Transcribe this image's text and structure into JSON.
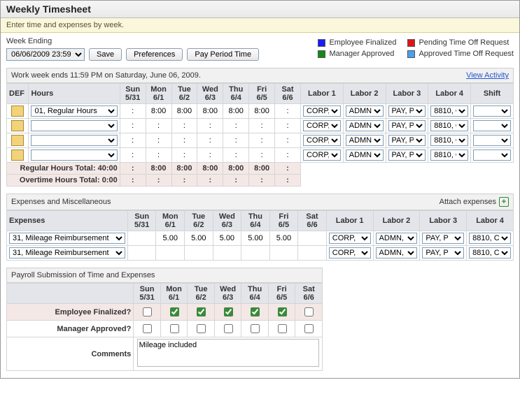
{
  "title": "Weekly Timesheet",
  "instruction": "Enter time and expenses by week.",
  "week_ending_label": "Week Ending",
  "week_ending_value": "06/06/2009 23:59",
  "buttons": {
    "save": "Save",
    "preferences": "Preferences",
    "pay_period": "Pay Period Time"
  },
  "legend": {
    "emp_finalized": {
      "label": "Employee Finalized",
      "color": "#1a1aff"
    },
    "pending_timeoff": {
      "label": "Pending Time Off Request",
      "color": "#e31313"
    },
    "mgr_approved": {
      "label": "Manager Approved",
      "color": "#138a13"
    },
    "approved_timeoff": {
      "label": "Approved Time Off Request",
      "color": "#4b9ff0"
    }
  },
  "work_week_msg": "Work week ends 11:59 PM on Saturday, June 06, 2009.",
  "view_activity": "View Activity",
  "days": [
    {
      "d": "Sun",
      "dt": "5/31"
    },
    {
      "d": "Mon",
      "dt": "6/1"
    },
    {
      "d": "Tue",
      "dt": "6/2"
    },
    {
      "d": "Wed",
      "dt": "6/3"
    },
    {
      "d": "Thu",
      "dt": "6/4"
    },
    {
      "d": "Fri",
      "dt": "6/5"
    },
    {
      "d": "Sat",
      "dt": "6/6"
    }
  ],
  "hours_headers": {
    "def": "DEF",
    "hours": "Hours",
    "labor1": "Labor 1",
    "labor2": "Labor 2",
    "labor3": "Labor 3",
    "labor4": "Labor 4",
    "shift": "Shift"
  },
  "labor_vals": {
    "l1": "CORP,",
    "l2": "ADMN,",
    "l3": "PAY, P",
    "l4": "8810, C"
  },
  "hours_rows": [
    {
      "type": "01, Regular Hours",
      "vals": [
        ":",
        "8:00",
        "8:00",
        "8:00",
        "8:00",
        "8:00",
        ":"
      ]
    },
    {
      "type": "",
      "vals": [
        ":",
        ":",
        ":",
        ":",
        ":",
        ":",
        ":"
      ]
    },
    {
      "type": "",
      "vals": [
        ":",
        ":",
        ":",
        ":",
        ":",
        ":",
        ":"
      ]
    },
    {
      "type": "",
      "vals": [
        ":",
        ":",
        ":",
        ":",
        ":",
        ":",
        ":"
      ]
    }
  ],
  "totals": {
    "regular": {
      "label": "Regular Hours Total:",
      "grand": "40:00",
      "vals": [
        ":",
        "8:00",
        "8:00",
        "8:00",
        "8:00",
        "8:00",
        ":"
      ]
    },
    "overtime": {
      "label": "Overtime Hours Total:",
      "grand": "0:00",
      "vals": [
        ":",
        ":",
        ":",
        ":",
        ":",
        ":",
        ":"
      ]
    }
  },
  "expenses_section": "Expenses and Miscellaneous",
  "attach_label": "Attach expenses",
  "expenses_headers": {
    "exp": "Expenses",
    "labor1": "Labor 1",
    "labor2": "Labor 2",
    "labor3": "Labor 3",
    "labor4": "Labor 4"
  },
  "expense_rows": [
    {
      "type": "31, Mileage Reimbursement",
      "vals": [
        "",
        "5.00",
        "5.00",
        "5.00",
        "5.00",
        "5.00",
        ""
      ]
    },
    {
      "type": "31, Mileage Reimbursement",
      "vals": [
        "",
        "",
        "",
        "",
        "",
        "",
        ""
      ]
    }
  ],
  "payroll_section": "Payroll Submission of Time and Expenses",
  "payroll_rows": {
    "emp_final": {
      "label": "Employee Finalized?",
      "checked": [
        false,
        true,
        true,
        true,
        true,
        true,
        false
      ]
    },
    "mgr_appr": {
      "label": "Manager Approved?",
      "checked": [
        false,
        false,
        false,
        false,
        false,
        false,
        false
      ]
    }
  },
  "comments_label": "Comments",
  "comments_value": "Mileage included"
}
